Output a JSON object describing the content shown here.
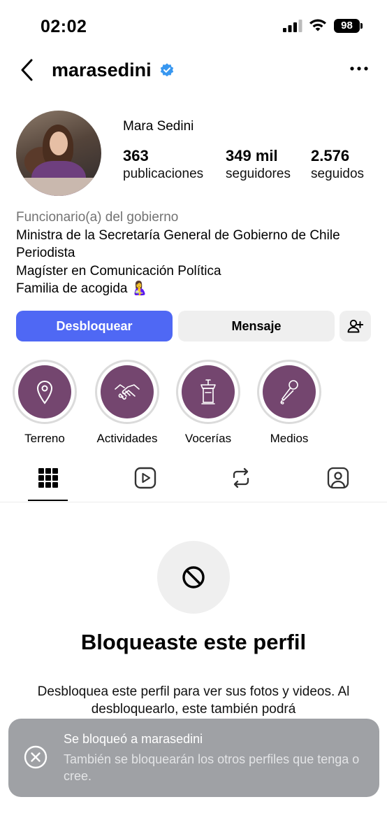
{
  "status_bar": {
    "time": "02:02",
    "battery": "98"
  },
  "header": {
    "username": "marasedini",
    "verified": true,
    "back_icon": "chevron-left-icon",
    "more_icon": "ellipsis-icon"
  },
  "profile": {
    "display_name": "Mara Sedini",
    "stats": [
      {
        "number": "363",
        "label": "publicaciones"
      },
      {
        "number": "349 mil",
        "label": "seguidores"
      },
      {
        "number": "2.576",
        "label": "seguidos"
      }
    ],
    "category": "Funcionario(a) del gobierno",
    "bio_lines": [
      "Ministra de la Secretaría General de Gobierno de Chile",
      "Periodista",
      "Magíster en Comunicación Política",
      "Familia de acogida 🤱"
    ]
  },
  "actions": {
    "unblock_label": "Desbloquear",
    "message_label": "Mensaje",
    "add_user_icon": "add-person-icon"
  },
  "highlights": [
    {
      "label": "Terreno",
      "icon": "map-pin-icon"
    },
    {
      "label": "Actividades",
      "icon": "handshake-icon"
    },
    {
      "label": "Vocerías",
      "icon": "podium-icon"
    },
    {
      "label": "Medios",
      "icon": "microphone-icon"
    }
  ],
  "tabs": [
    {
      "icon": "grid-icon",
      "active": true
    },
    {
      "icon": "reels-icon",
      "active": false
    },
    {
      "icon": "repost-icon",
      "active": false
    },
    {
      "icon": "tagged-icon",
      "active": false
    }
  ],
  "blocked": {
    "title": "Bloqueaste este perfil",
    "description": "Desbloquea este perfil para ver sus fotos y videos. Al desbloquearlo, este también podrá"
  },
  "toast": {
    "title": "Se bloqueó a marasedini",
    "body": "También se bloquearán los otros perfiles que tenga o cree."
  },
  "colors": {
    "primary_button": "#4f68f4",
    "highlight_fill": "#74466f",
    "verified_badge": "#3897f0"
  }
}
